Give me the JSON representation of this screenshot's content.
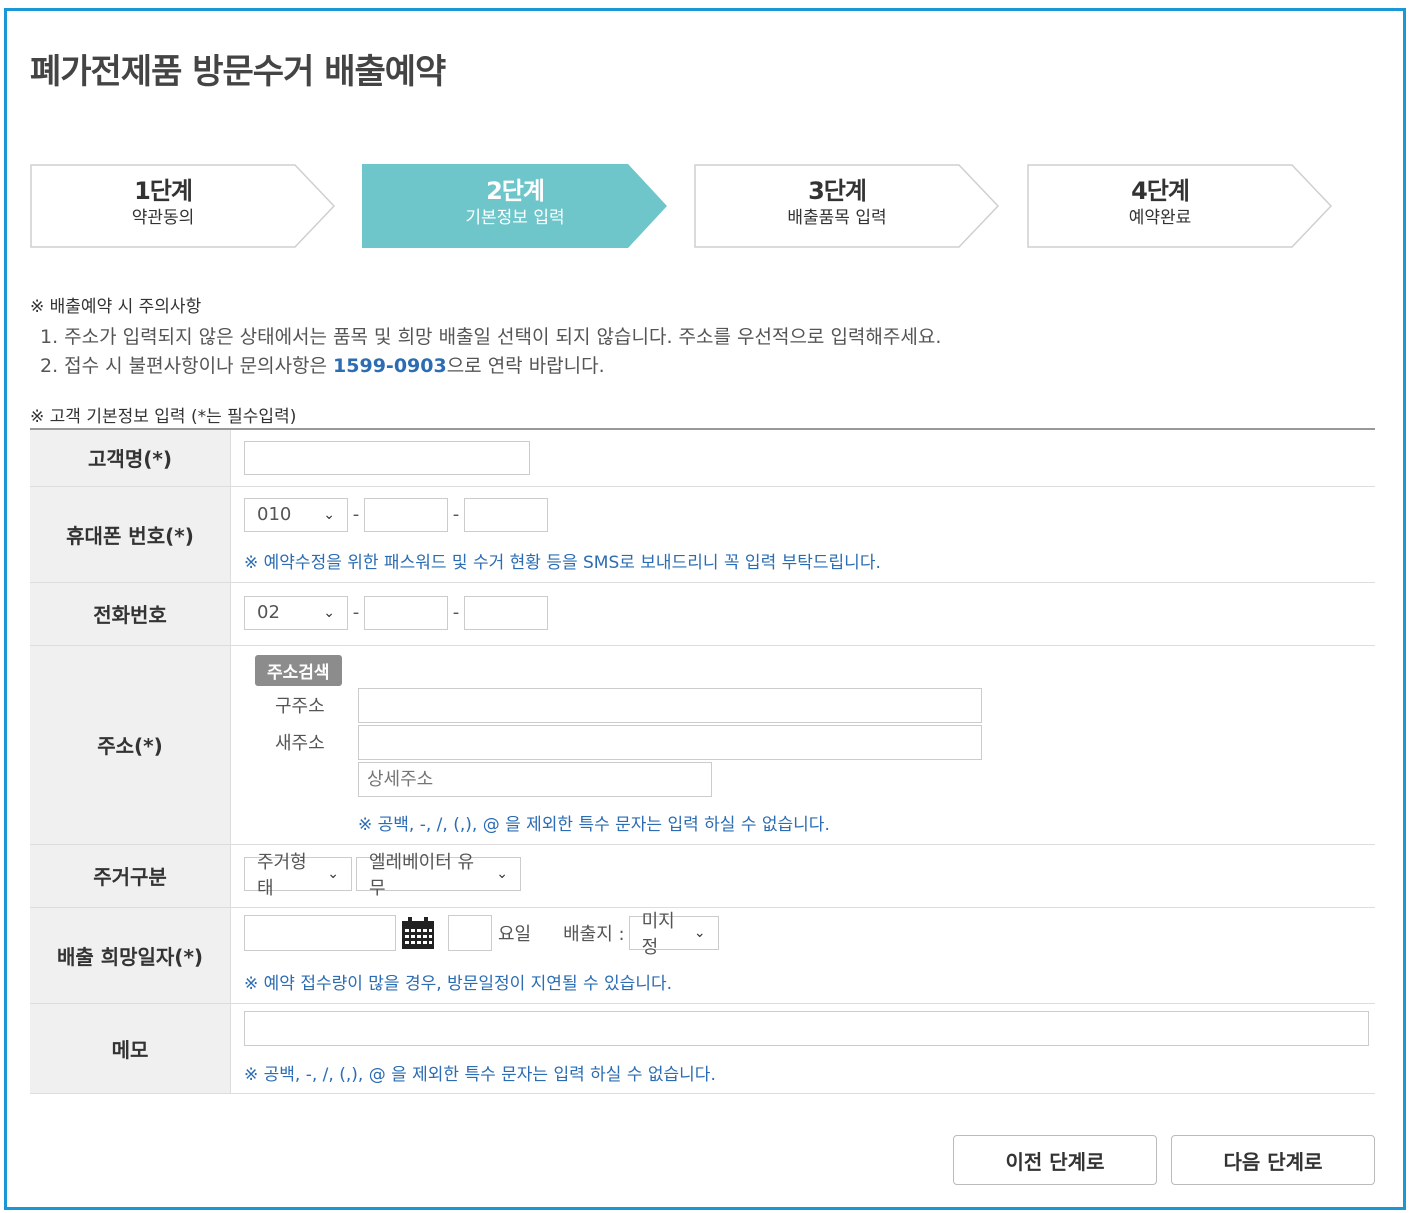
{
  "page": {
    "title": "폐가전제품 방문수거 배출예약"
  },
  "steps": [
    {
      "num": "1단계",
      "label": "약관동의",
      "active": false
    },
    {
      "num": "2단계",
      "label": "기본정보 입력",
      "active": true
    },
    {
      "num": "3단계",
      "label": "배출품목 입력",
      "active": false
    },
    {
      "num": "4단계",
      "label": "예약완료",
      "active": false
    }
  ],
  "colors": {
    "accent": "#6ec6ca",
    "frame": "#1a97d5",
    "link": "#2b6cb3"
  },
  "notice": {
    "heading": "※ 배출예약 시 주의사항",
    "item1": "1. 주소가 입력되지 않은 상태에서는 품목 및 희망 배출일 선택이 되지 않습니다. 주소를 우선적으로 입력해주세요.",
    "item2_pre": "2. 접수 시 불편사항이나 문의사항은 ",
    "item2_phone": "1599-0903",
    "item2_post": "으로 연락 바랍니다."
  },
  "form": {
    "heading": "※ 고객 기본정보 입력 (*는 필수입력)",
    "name_label": "고객명(*)",
    "mobile_label": "휴대폰 번호(*)",
    "mobile_prefix": "010",
    "mobile_help": "※ 예약수정을 위한 패스워드 및 수거 현황 등을 SMS로 보내드리니 꼭 입력 부탁드립니다.",
    "tel_label": "전화번호",
    "tel_prefix": "02",
    "dash": "-",
    "address_label": "주소(*)",
    "address_search": "주소검색",
    "old_address_label": "구주소",
    "new_address_label": "새주소",
    "detail_placeholder": "상세주소",
    "address_help": "※ 공백, -, /, (,), @ 을 제외한 특수 문자는 입력 하실 수 없습니다.",
    "housing_label": "주거구분",
    "housing_type": "주거형태",
    "elevator": "엘레베이터 유무",
    "date_label": "배출 희망일자(*)",
    "weekday_suffix": "요일",
    "place_label": "배출지 :",
    "place_value": "미지정",
    "date_help": "※ 예약 접수량이 많을 경우, 방문일정이 지연될 수 있습니다.",
    "memo_label": "메모",
    "memo_help": "※ 공백, -, /, (,), @ 을 제외한 특수 문자는 입력 하실 수 없습니다."
  },
  "buttons": {
    "prev": "이전 단계로",
    "next": "다음 단계로"
  },
  "icons": {
    "calendar": "calendar-icon",
    "dropdown": "chevron-down-icon"
  }
}
